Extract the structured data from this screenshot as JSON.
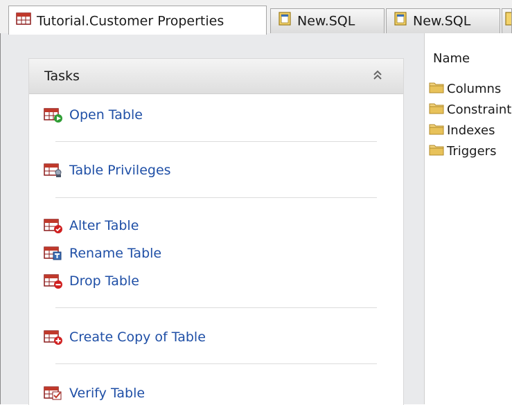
{
  "tabs": [
    {
      "label": "Tutorial.Customer Properties",
      "icon": "table-icon",
      "active": true
    },
    {
      "label": "New.SQL",
      "icon": "sql-document-icon",
      "active": false
    },
    {
      "label": "New.SQL",
      "icon": "sql-document-icon",
      "active": false
    }
  ],
  "tasks_panel": {
    "title": "Tasks",
    "collapse_icon": "double-chevron-up-icon",
    "items": [
      {
        "label": "Open Table",
        "icon": "open-table-icon"
      },
      {
        "label": "Table Privileges",
        "icon": "table-privileges-icon"
      },
      {
        "label": "Alter Table",
        "icon": "alter-table-icon"
      },
      {
        "label": "Rename Table",
        "icon": "rename-table-icon"
      },
      {
        "label": "Drop Table",
        "icon": "drop-table-icon"
      },
      {
        "label": "Create Copy of Table",
        "icon": "copy-table-icon"
      },
      {
        "label": "Verify Table",
        "icon": "verify-table-icon"
      }
    ]
  },
  "object_tree": {
    "column_header": "Name",
    "items": [
      {
        "label": "Columns",
        "icon": "folder-icon"
      },
      {
        "label": "Constraints",
        "icon": "folder-icon"
      },
      {
        "label": "Indexes",
        "icon": "folder-icon"
      },
      {
        "label": "Triggers",
        "icon": "folder-icon"
      }
    ]
  },
  "colors": {
    "link": "#1f4fa6",
    "panel_bg": "#e9eaec",
    "folder": "#e8c25a"
  }
}
